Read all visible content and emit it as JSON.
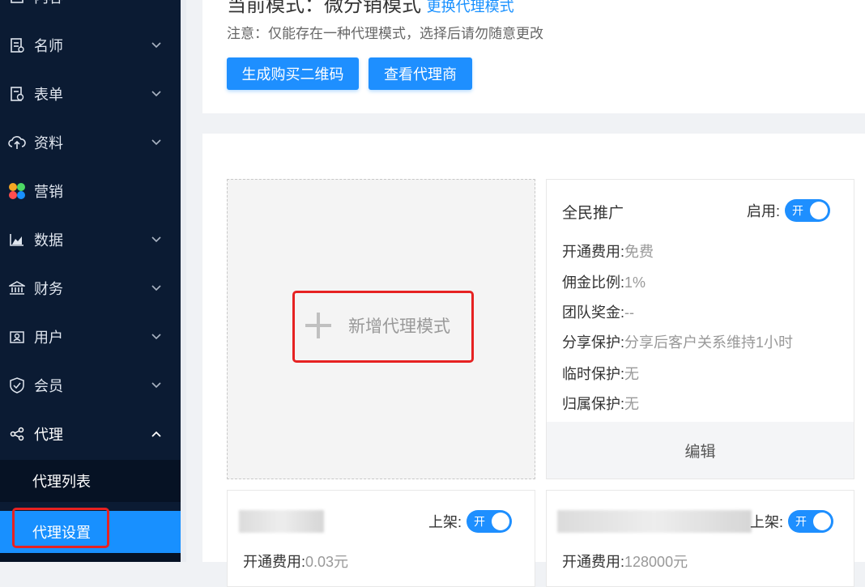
{
  "sidebar": {
    "items": [
      {
        "label": "内容",
        "icon": "content-icon"
      },
      {
        "label": "名师",
        "icon": "teacher-icon"
      },
      {
        "label": "表单",
        "icon": "form-icon"
      },
      {
        "label": "资料",
        "icon": "cloud-upload-icon"
      },
      {
        "label": "营销",
        "icon": "marketing-color-icon"
      },
      {
        "label": "数据",
        "icon": "chart-icon"
      },
      {
        "label": "财务",
        "icon": "bank-icon"
      },
      {
        "label": "用户",
        "icon": "user-card-icon"
      },
      {
        "label": "会员",
        "icon": "shield-icon"
      },
      {
        "label": "代理",
        "icon": "share-icon"
      }
    ],
    "sub_items": [
      {
        "label": "代理列表"
      },
      {
        "label": "代理设置"
      }
    ],
    "accent": "#1890ff",
    "background": "#0b1b33"
  },
  "header": {
    "title": "当前模式：微分销模式",
    "switch_link": "更换代理模式",
    "note": "注意：仅能存在一种代理模式，选择后请勿随意更改",
    "buttons": {
      "generate_qr": "生成购买二维码",
      "view_agents": "查看代理商"
    }
  },
  "add_mode": {
    "label": "新增代理模式"
  },
  "mode_card": {
    "name": "全民推广",
    "enable_label": "启用:",
    "toggle_text": "开",
    "rows": [
      {
        "label": "开通费用:",
        "value": "免费"
      },
      {
        "label": "佣金比例:",
        "value": "1%"
      },
      {
        "label": "团队奖金:",
        "value": "--"
      },
      {
        "label": "分享保护:",
        "value": "分享后客户关系维持1小时"
      },
      {
        "label": "临时保护:",
        "value": "无"
      },
      {
        "label": "归属保护:",
        "value": "无"
      }
    ],
    "edit_label": "编辑"
  },
  "bottom_cards": [
    {
      "shelf_label": "上架:",
      "toggle_text": "开",
      "fee_label": "开通费用:",
      "fee_value": "0.03元"
    },
    {
      "shelf_label": "上架:",
      "toggle_text": "开",
      "fee_label": "开通费用:",
      "fee_value": "128000元"
    }
  ]
}
